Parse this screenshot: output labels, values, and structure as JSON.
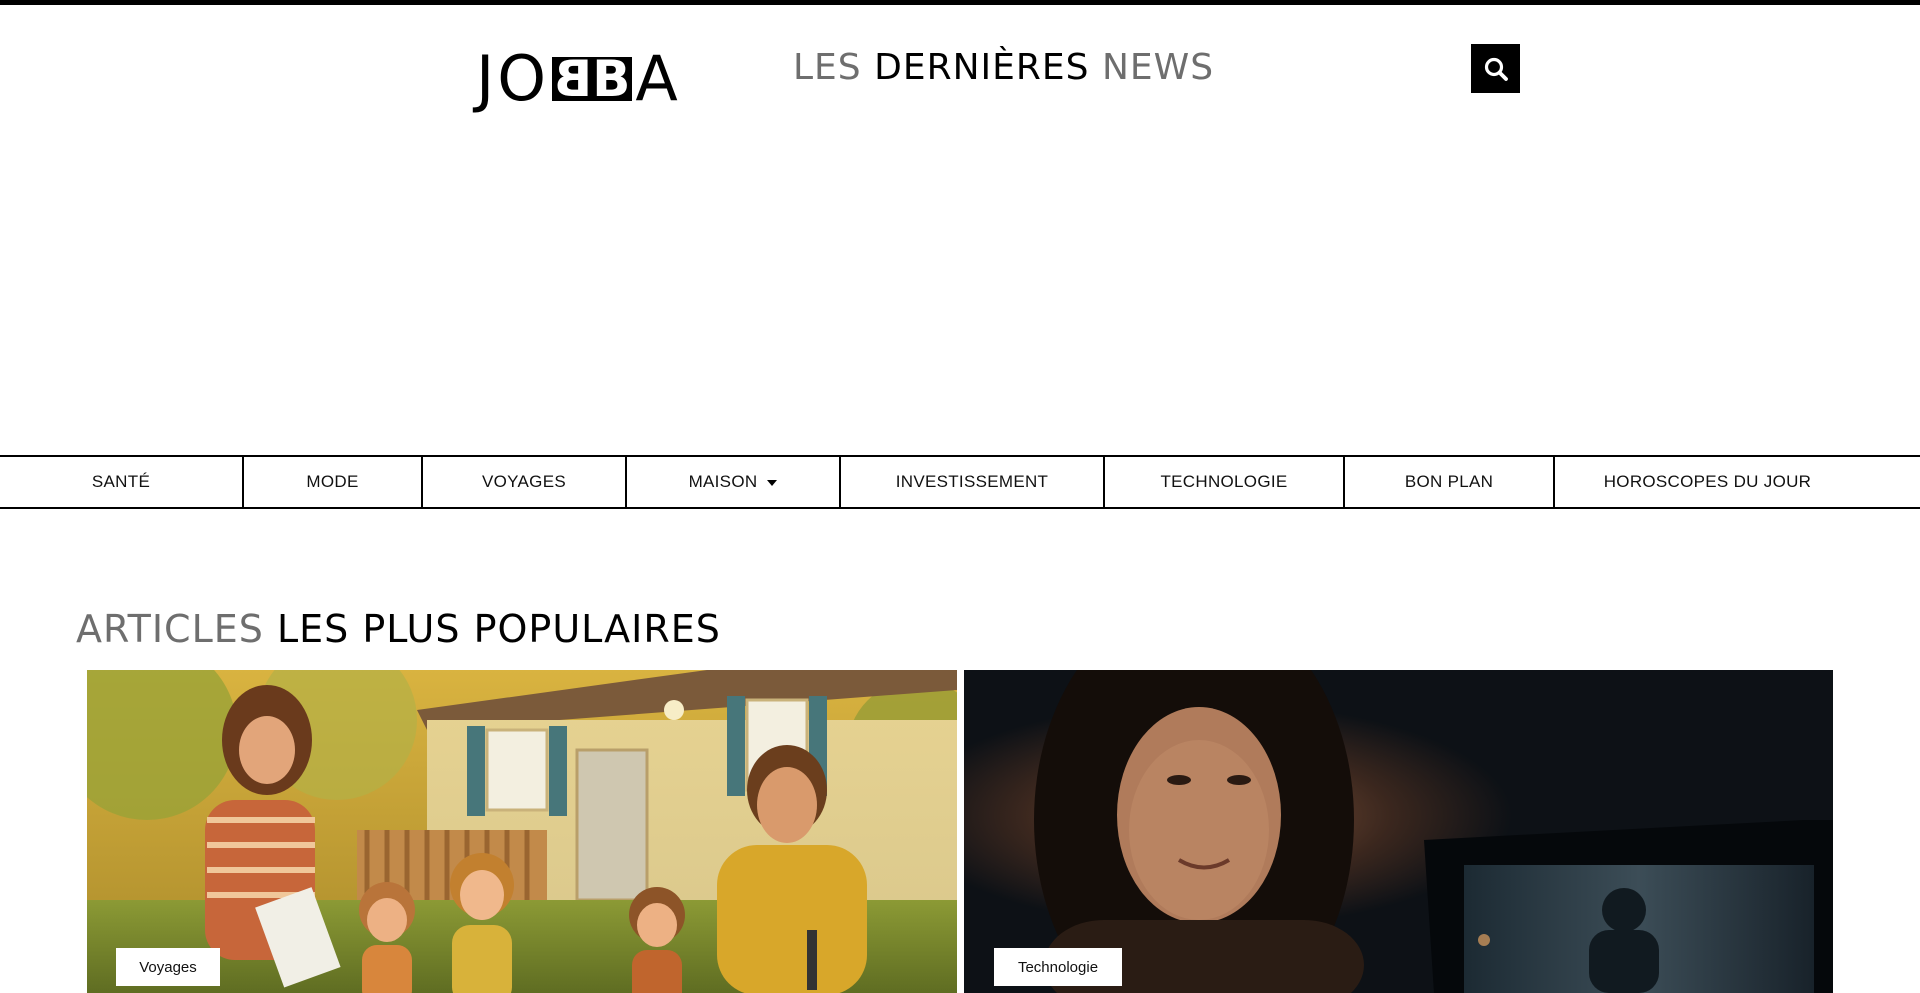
{
  "logo": {
    "before": "JO",
    "after": "A"
  },
  "tagline": {
    "part1": "LES",
    "part2": "DERNIÈRES",
    "part3": "NEWS"
  },
  "search": {
    "icon": "search-icon"
  },
  "nav": {
    "items": [
      {
        "label": "SANTÉ"
      },
      {
        "label": "MODE"
      },
      {
        "label": "VOYAGES"
      },
      {
        "label": "MAISON",
        "has_dropdown": true
      },
      {
        "label": "INVESTISSEMENT"
      },
      {
        "label": "TECHNOLOGIE"
      },
      {
        "label": "BON PLAN"
      },
      {
        "label": "HOROSCOPES DU JOUR"
      }
    ]
  },
  "section": {
    "title_light": "ARTICLES",
    "title_dark": "LES PLUS POPULAIRES"
  },
  "articles": [
    {
      "category": "Voyages"
    },
    {
      "category": "Technologie"
    }
  ],
  "colors": {
    "primary": "#000000",
    "background": "#ffffff"
  }
}
